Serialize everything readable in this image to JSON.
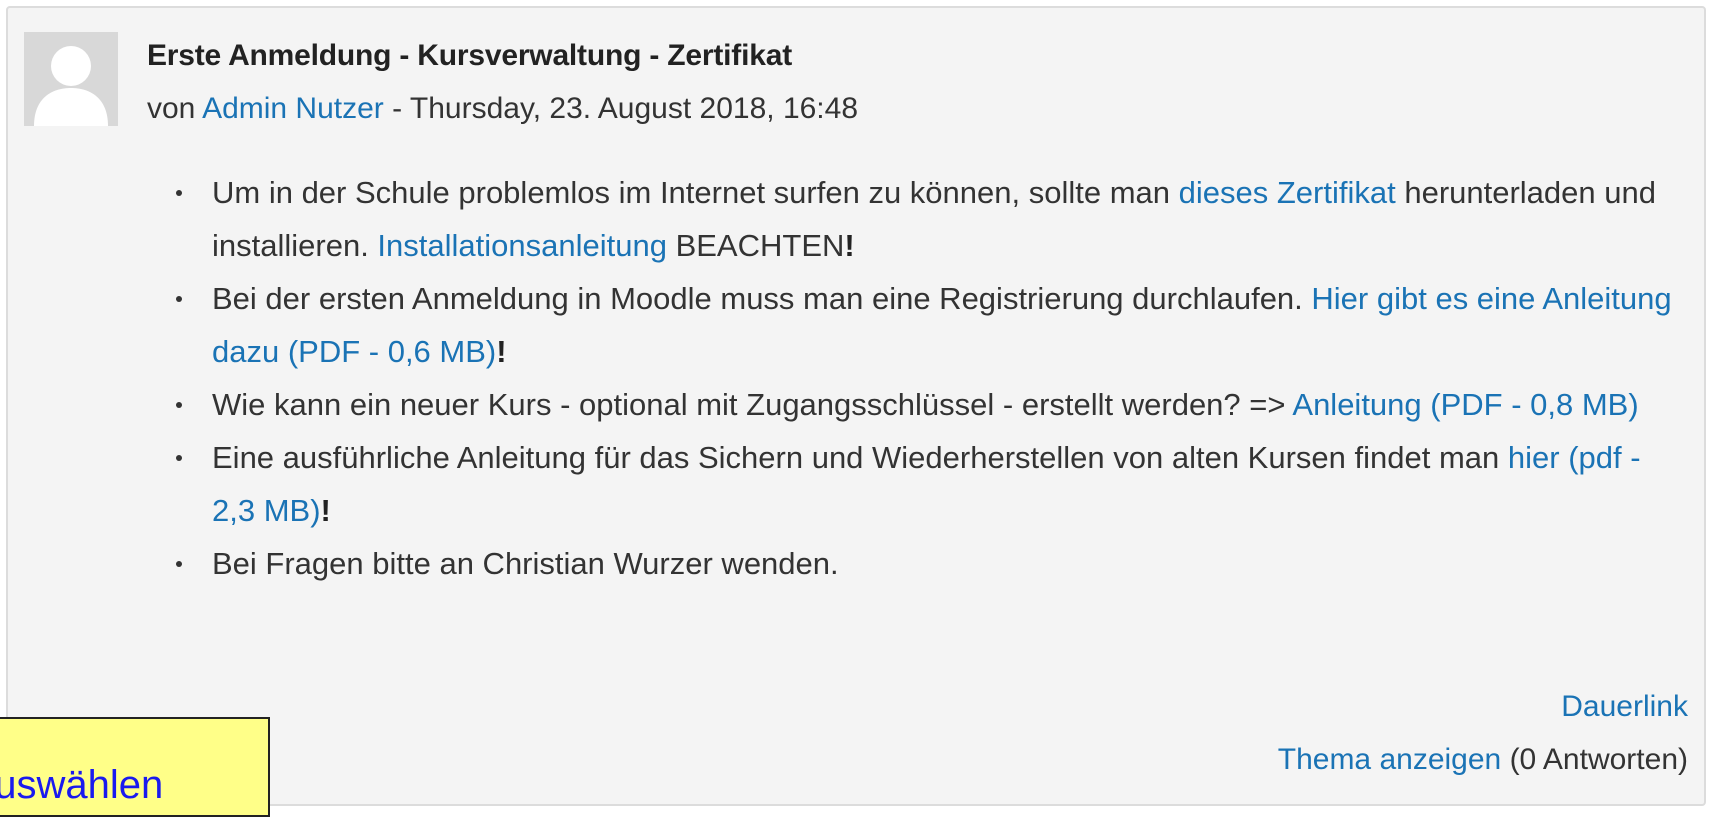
{
  "post": {
    "subject": "Erste Anmeldung - Kursverwaltung - Zertifikat",
    "by_prefix": "von ",
    "author": "Admin Nutzer",
    "date": " - Thursday, 23. August 2018, 16:48",
    "avatar_icon": "user-avatar-icon"
  },
  "items": [
    {
      "t1": "Um in der Schule problemlos im Internet surfen zu können, sollte man ",
      "link1": "dieses Zertifikat",
      "t2": " herunterladen und installieren. ",
      "link2": "Installationsanleitung",
      "t3": " BEACHTEN",
      "t4": "!"
    },
    {
      "t1": "Bei der ersten Anmeldung in Moodle muss man eine Registrierung durchlaufen. ",
      "link1": "Hier gibt es eine Anleitung dazu (PDF - 0,6 MB)",
      "t2": "!"
    },
    {
      "t1": "Wie kann ein neuer Kurs - optional mit Zugangsschlüssel - erstellt werden? => ",
      "link1": "Anleitung (PDF - 0,8 MB)"
    },
    {
      "t1": "Eine ausführliche Anleitung für das Sichern und Wiederherstellen von alten Kursen findet man ",
      "link1": "hier (pdf - 2,3 MB)",
      "t2": "!"
    },
    {
      "t1": "Bei Fragen bitte an Christian Wurzer wenden."
    }
  ],
  "footer": {
    "permalink": "Dauerlink",
    "discuss": "Thema anzeigen",
    "replies": " (0 Antworten)"
  },
  "tooltip": {
    "text": "auswählen"
  },
  "colors": {
    "link": "#1a73b5",
    "post_bg": "#f4f4f4",
    "tooltip_bg": "#ffff88"
  }
}
